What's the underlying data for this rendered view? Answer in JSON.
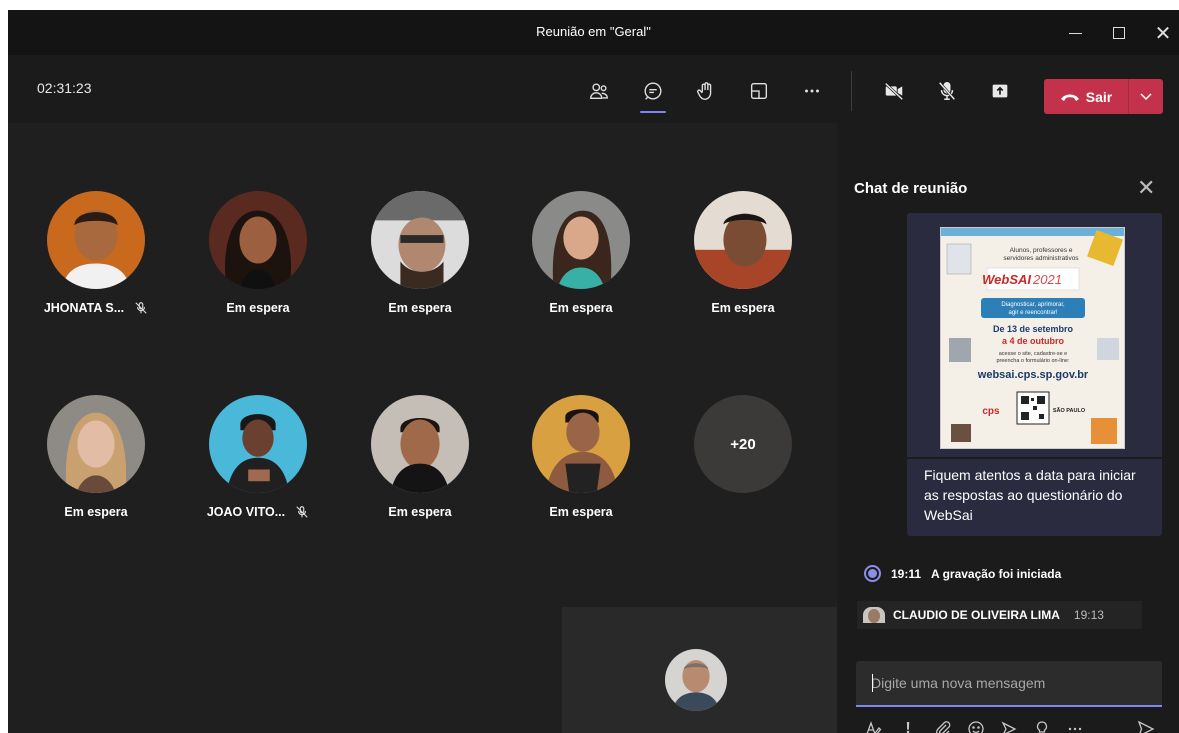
{
  "window": {
    "title": "Reunião em \"Geral\"",
    "minimize_icon": "minimize-icon",
    "maximize_icon": "maximize-icon",
    "close_icon": "close-icon"
  },
  "controls": {
    "timer": "02:31:23",
    "leave_label": "Sair",
    "leave_color": "#c4314b",
    "active_color": "#7f85f5",
    "icons": [
      "participants-icon",
      "chat-icon",
      "raise-hand-icon",
      "rooms-icon",
      "more-icon",
      "camera-off-icon",
      "mic-off-icon",
      "share-icon"
    ]
  },
  "participants": [
    {
      "name": "JHONATA S...",
      "muted": true,
      "avatar": "person-avatar-1"
    },
    {
      "name": "Em espera",
      "muted": false,
      "avatar": "person-avatar-2"
    },
    {
      "name": "Em espera",
      "muted": false,
      "avatar": "person-avatar-3"
    },
    {
      "name": "Em espera",
      "muted": false,
      "avatar": "person-avatar-4"
    },
    {
      "name": "Em espera",
      "muted": false,
      "avatar": "person-avatar-5"
    },
    {
      "name": "Em espera",
      "muted": false,
      "avatar": "person-avatar-6"
    },
    {
      "name": "JOAO VITO...",
      "muted": true,
      "avatar": "person-avatar-7"
    },
    {
      "name": "Em espera",
      "muted": false,
      "avatar": "person-avatar-8"
    },
    {
      "name": "Em espera",
      "muted": false,
      "avatar": "person-avatar-9"
    }
  ],
  "overflow_count": "+20",
  "chat": {
    "title": "Chat de reunião",
    "poster": {
      "line1": "Alunos, professores e",
      "line2": "servidores administrativos",
      "brand": "WebSAI",
      "year": "2021",
      "tagline1": "Diagnosticar, aprimorar,",
      "tagline2": "agir e reencontrar!",
      "date1": "De 13 de setembro",
      "date2": "a 4 de outubro",
      "small1": "acesse o site, cadastre-se e",
      "small2": "preencha o formulário on-line:",
      "url": "websai.cps.sp.gov.br",
      "logo1": "cps",
      "logo2": "SÃO PAULO"
    },
    "message": "Fiquem atentos a data para iniciar as respostas ao questionário do WebSai",
    "recording_time": "19:11",
    "recording_text": "A gravação foi iniciada",
    "sender": "CLAUDIO DE OLIVEIRA LIMA",
    "sender_time": "19:13",
    "compose_placeholder": "Digite uma nova mensagem",
    "tool_icons": [
      "format-icon",
      "important-icon",
      "attach-icon",
      "emoji-icon",
      "giphy-icon",
      "praise-icon",
      "more-options-icon",
      "send-icon"
    ]
  }
}
